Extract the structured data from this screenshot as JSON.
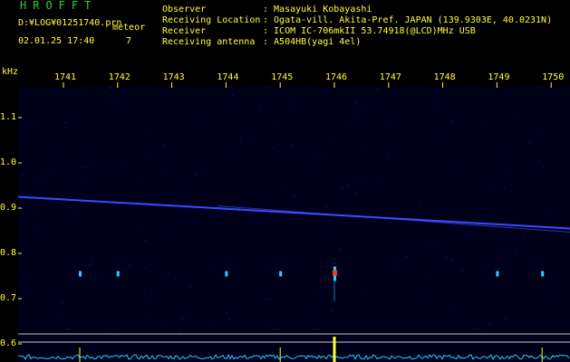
{
  "header": {
    "title": "HROFFT",
    "log_path": "D:¥LOG¥01251740.prn",
    "mode": "meteor",
    "datetime": "02.01.25 17:40",
    "count": "7"
  },
  "info": [
    {
      "label": "Observer",
      "value": ": Masayuki Kobayashi"
    },
    {
      "label": "Receiving Location",
      "value": ": Ogata-vill. Akita-Pref. JAPAN (139.9303E, 40.0231N)"
    },
    {
      "label": "Receiver",
      "value": ": ICOM IC-706mkII 53.74918(@LCD)MHz USB"
    },
    {
      "label": "Receiving antenna",
      "value": ": A504HB(yagi 4el)"
    }
  ],
  "spectrogram": {
    "freq_unit": "kHz",
    "y_ticks": [
      "1.1",
      "1.0",
      "0.9",
      "0.8",
      "0.7",
      "0.6"
    ],
    "time_ticks": [
      "1741",
      "1742",
      "1743",
      "1744",
      "1745",
      "1746",
      "1747",
      "1748",
      "1749",
      "1750"
    ],
    "colors": {
      "background": "#00001a",
      "label": "#ffff3a",
      "carrier": "#3a4cff",
      "trace": "#1ed3ff",
      "meteor_head": "#ff3030",
      "gridline": "#c8c8c8"
    },
    "carrier_freq_start_khz": 0.925,
    "carrier_freq_end_khz": 0.855,
    "meteor_freq_khz": 0.755,
    "meteor_echo_times": [
      "1741",
      "1742",
      "1744",
      "1745",
      "1746",
      "1749",
      "1750"
    ]
  }
}
